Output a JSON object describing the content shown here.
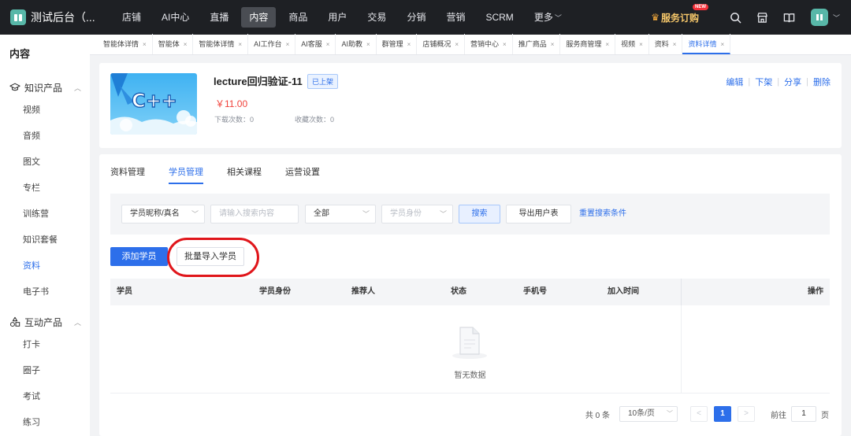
{
  "app": {
    "title": "测试后台（..."
  },
  "nav": [
    {
      "label": "店铺"
    },
    {
      "label": "AI中心"
    },
    {
      "label": "直播"
    },
    {
      "label": "内容"
    },
    {
      "label": "商品"
    },
    {
      "label": "用户"
    },
    {
      "label": "交易"
    },
    {
      "label": "分销"
    },
    {
      "label": "营销"
    },
    {
      "label": "SCRM"
    },
    {
      "label": "更多"
    }
  ],
  "nav_active": "内容",
  "top_right": {
    "subscribe_label": "服务订购",
    "new_badge": "NEW"
  },
  "sidebar": {
    "title": "内容",
    "groups": [
      {
        "label": "知识产品",
        "icon": "graduation-cap-icon",
        "items": [
          {
            "label": "视频"
          },
          {
            "label": "音频"
          },
          {
            "label": "图文"
          },
          {
            "label": "专栏"
          },
          {
            "label": "训练营"
          },
          {
            "label": "知识套餐"
          },
          {
            "label": "资料"
          },
          {
            "label": "电子书"
          }
        ]
      },
      {
        "label": "互动产品",
        "icon": "shapes-icon",
        "items": [
          {
            "label": "打卡"
          },
          {
            "label": "圈子"
          },
          {
            "label": "考试"
          },
          {
            "label": "练习"
          }
        ]
      }
    ],
    "active_item": "资料"
  },
  "page_tabs": [
    {
      "label": "智能体详情"
    },
    {
      "label": "智能体"
    },
    {
      "label": "智能体详情"
    },
    {
      "label": "AI工作台"
    },
    {
      "label": "AI客服"
    },
    {
      "label": "AI助教"
    },
    {
      "label": "群管理"
    },
    {
      "label": "店铺概况"
    },
    {
      "label": "营销中心"
    },
    {
      "label": "推广商品"
    },
    {
      "label": "服务商管理"
    },
    {
      "label": "视频"
    },
    {
      "label": "资料"
    },
    {
      "label": "资料详情"
    }
  ],
  "page_tabs_close": "×",
  "product": {
    "cover_text": "C++",
    "title": "lecture回归验证-11",
    "status": "已上架",
    "price": "￥11.00",
    "downloads_label": "下载次数：",
    "downloads": "0",
    "favorites_label": "收藏次数：",
    "favorites": "0",
    "actions": {
      "edit": "编辑",
      "take_down": "下架",
      "share": "分享",
      "delete": "删除"
    }
  },
  "main_tabs": [
    {
      "label": "资料管理"
    },
    {
      "label": "学员管理"
    },
    {
      "label": "相关课程"
    },
    {
      "label": "运营设置"
    }
  ],
  "main_tab_active": "学员管理",
  "filter": {
    "field_select": "学员昵称/真名",
    "search_placeholder": "请输入搜索内容",
    "scope_select": "全部",
    "identity_placeholder": "学员身份",
    "search_button": "搜索",
    "export_button": "导出用户表",
    "reset_link": "重置搜索条件"
  },
  "actions": {
    "add_student": "添加学员",
    "batch_import": "批量导入学员"
  },
  "table": {
    "columns": [
      "学员",
      "学员身份",
      "推荐人",
      "状态",
      "手机号",
      "加入时间",
      "操作"
    ],
    "empty_text": "暂无数据"
  },
  "pagination": {
    "total": "共 0 条",
    "page_size": "10条/页",
    "prev": "<",
    "next": ">",
    "current": "1",
    "goto_label": "前往",
    "goto_value": "1",
    "page_unit": "页"
  },
  "colors": {
    "accent": "#2d6fea",
    "topbar": "#1e2024",
    "price": "#f0413a",
    "highlight_ring": "#e0161b"
  }
}
